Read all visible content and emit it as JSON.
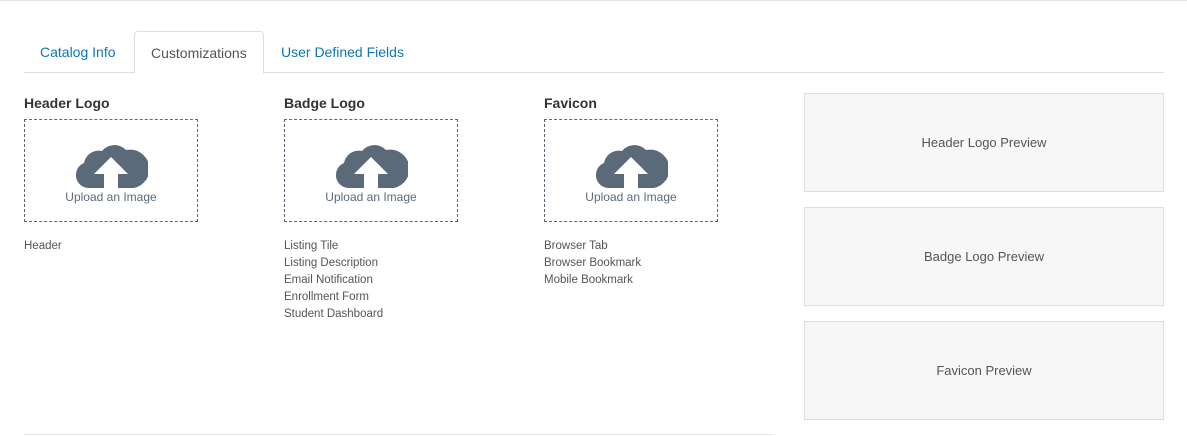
{
  "tabs": [
    {
      "label": "Catalog Info"
    },
    {
      "label": "Customizations"
    },
    {
      "label": "User Defined Fields"
    }
  ],
  "columns": [
    {
      "title": "Header Logo",
      "upload_label": "Upload an Image",
      "uses": [
        "Header"
      ]
    },
    {
      "title": "Badge Logo",
      "upload_label": "Upload an Image",
      "uses": [
        "Listing Tile",
        "Listing Description",
        "Email Notification",
        "Enrollment Form",
        "Student Dashboard"
      ]
    },
    {
      "title": "Favicon",
      "upload_label": "Upload an Image",
      "uses": [
        "Browser Tab",
        "Browser Bookmark",
        "Mobile Bookmark"
      ]
    }
  ],
  "previews": [
    "Header Logo Preview",
    "Badge Logo Preview",
    "Favicon Preview"
  ],
  "colors": {
    "link": "#0a77b5",
    "icon": "#5a6a78"
  }
}
